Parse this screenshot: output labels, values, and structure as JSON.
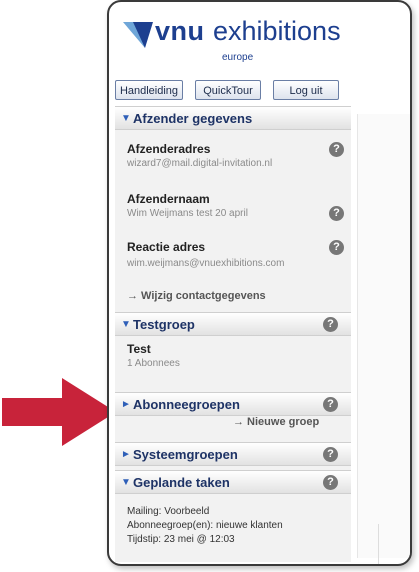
{
  "logo": {
    "brand": "vnu",
    "name": "exhibitions",
    "region": "europe"
  },
  "toolbar": {
    "manual": "Handleiding",
    "tour": "QuickTour",
    "logout": "Log uit"
  },
  "sections": {
    "sender": {
      "title": "Afzender gegevens",
      "address_label": "Afzenderadres",
      "address_value": "wizard7@mail.digital-invitation.nl",
      "name_label": "Afzendernaam",
      "name_value": "Wim Weijmans test 20 april",
      "reply_label": "Reactie adres",
      "reply_value": "wim.weijmans@vnuexhibitions.com",
      "edit_link": "→ Wijzig contactgegevens"
    },
    "testgroup": {
      "title": "Testgroep",
      "item_title": "Test",
      "item_sub": "1 Abonnees"
    },
    "subscriber_groups": {
      "title": "Abonneegroepen",
      "new_link": "→ Nieuwe groep"
    },
    "system_groups": {
      "title": "Systeemgroepen"
    },
    "scheduled_tasks": {
      "title": "Geplande taken",
      "mailing": "Mailing: Voorbeeld",
      "groups": "Abonneegroep(en): nieuwe klanten",
      "time": "Tijdstip: 23 mei @ 12:03"
    }
  },
  "help_symbol": "?",
  "colors": {
    "accent": "#1d3f8f",
    "arrow": "#c8233a"
  }
}
